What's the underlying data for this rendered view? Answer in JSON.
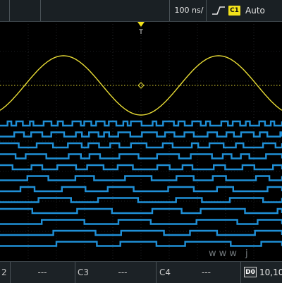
{
  "top_bar": {
    "timebase": "100 ns/",
    "trigger_source": "C1",
    "trigger_mode": "Auto",
    "trigger_marker": "T"
  },
  "waveform": {
    "analog_channel": "C1",
    "analog_color": "#e8dc35",
    "digital_color": "#1f8fd6",
    "digital_lanes": 12
  },
  "bottom_bar": {
    "channels": [
      {
        "label": "2",
        "value": "---"
      },
      {
        "label": "C3",
        "value": "---"
      },
      {
        "label": "C4",
        "value": "---"
      }
    ],
    "digital_badge": "D0",
    "digital_value": "10,10"
  },
  "watermark": "www  j"
}
